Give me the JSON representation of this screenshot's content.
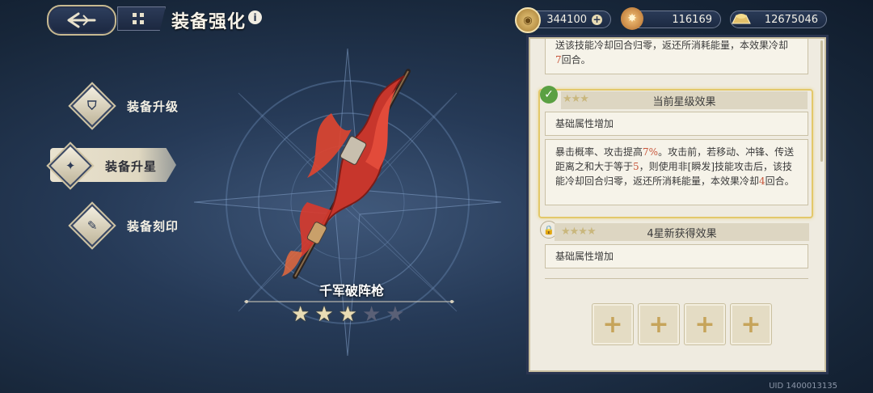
{
  "header": {
    "title": "装备强化",
    "info_icon": "info-icon",
    "back_icon": "back-arrow-icon",
    "home_icon": "grid-menu-icon"
  },
  "currencies": [
    {
      "icon": "coin-icon",
      "value": "344100",
      "has_add": true
    },
    {
      "icon": "star-crystal-icon",
      "value": "116169"
    },
    {
      "icon": "gold-ingot-icon",
      "value": "12675046"
    }
  ],
  "menu": [
    {
      "label": "装备升级",
      "icon": "upgrade-icon",
      "active": false
    },
    {
      "label": "装备升星",
      "icon": "star-up-icon",
      "active": true
    },
    {
      "label": "装备刻印",
      "icon": "engrave-icon",
      "active": false
    }
  ],
  "weapon": {
    "name": "千军破阵枪",
    "stars_filled": 3,
    "stars_total": 5
  },
  "panel": {
    "prev_text_line1": "送该技能冷却回合归零，返还所消耗能量，本效果冷却",
    "prev_text_line2_num": "7",
    "prev_text_line2_suffix": "回合。",
    "current": {
      "header": "当前星级效果",
      "base": "基础属性增加",
      "desc_a": "暴击概率、攻击提高",
      "desc_pct": "7%",
      "desc_b": "。攻击前，若移动、冲锋、传送距离之和大于等于",
      "desc_num": "5",
      "desc_c": "，则使用非[瞬发]技能攻击后，该技能冷却回合归零，返还所消耗能量，本效果冷却",
      "desc_cd": "4",
      "desc_d": "回合。"
    },
    "next": {
      "header": "4星新获得效果",
      "base": "基础属性增加"
    },
    "slots": [
      "+",
      "+",
      "+",
      "+"
    ]
  },
  "uid": "UID 1400013135",
  "colors": {
    "highlight": "#c8563b",
    "active_border": "#e3c86a",
    "star_on": "#e9dcb4"
  }
}
